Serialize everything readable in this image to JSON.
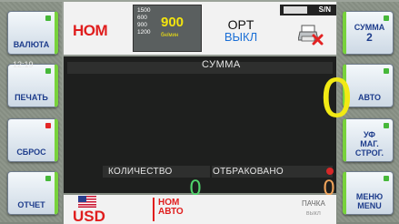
{
  "left_buttons": [
    {
      "label": "ВАЛЮТА",
      "led": "green"
    },
    {
      "label": "ПЕЧАТЬ",
      "led": "green"
    },
    {
      "label": "СБРОС",
      "led": "red"
    },
    {
      "label": "ОТЧЕТ",
      "led": "green"
    }
  ],
  "right_buttons": [
    {
      "label": "СУММА",
      "label2": "2",
      "led": "green"
    },
    {
      "label": "АВТО",
      "led": "green"
    },
    {
      "label": "УФ МАГ. СТРОГ.",
      "led": "green"
    },
    {
      "label": "МЕНЮ MENU",
      "led": "green"
    }
  ],
  "top": {
    "mode": "НОМ",
    "speed_options": [
      "1500",
      "600",
      "900",
      "1200"
    ],
    "speed_value": "900",
    "speed_unit": "бн/мин",
    "opt_label": "OPT",
    "opt_state": "ВЫКЛ",
    "sn_label": "S/N"
  },
  "display": {
    "time": "12:19",
    "sum_label": "СУММА",
    "sum_value": "0",
    "count_label": "КОЛИЧЕСТВО",
    "rejected_label": "ОТБРАКОВАНО",
    "count_value": "0",
    "rejected_value": "0"
  },
  "bottom": {
    "currency": "USD",
    "mode_line1": "НОМ",
    "mode_line2": "АВТО",
    "batch_label": "ПАЧКА",
    "batch_state": "выкл"
  },
  "colors": {
    "accent_red": "#e01e1e",
    "sum_yellow": "#f2ea14",
    "count_green": "#4fd46b",
    "rejected_orange": "#f0a35a",
    "button_text": "#1e3d8c"
  }
}
